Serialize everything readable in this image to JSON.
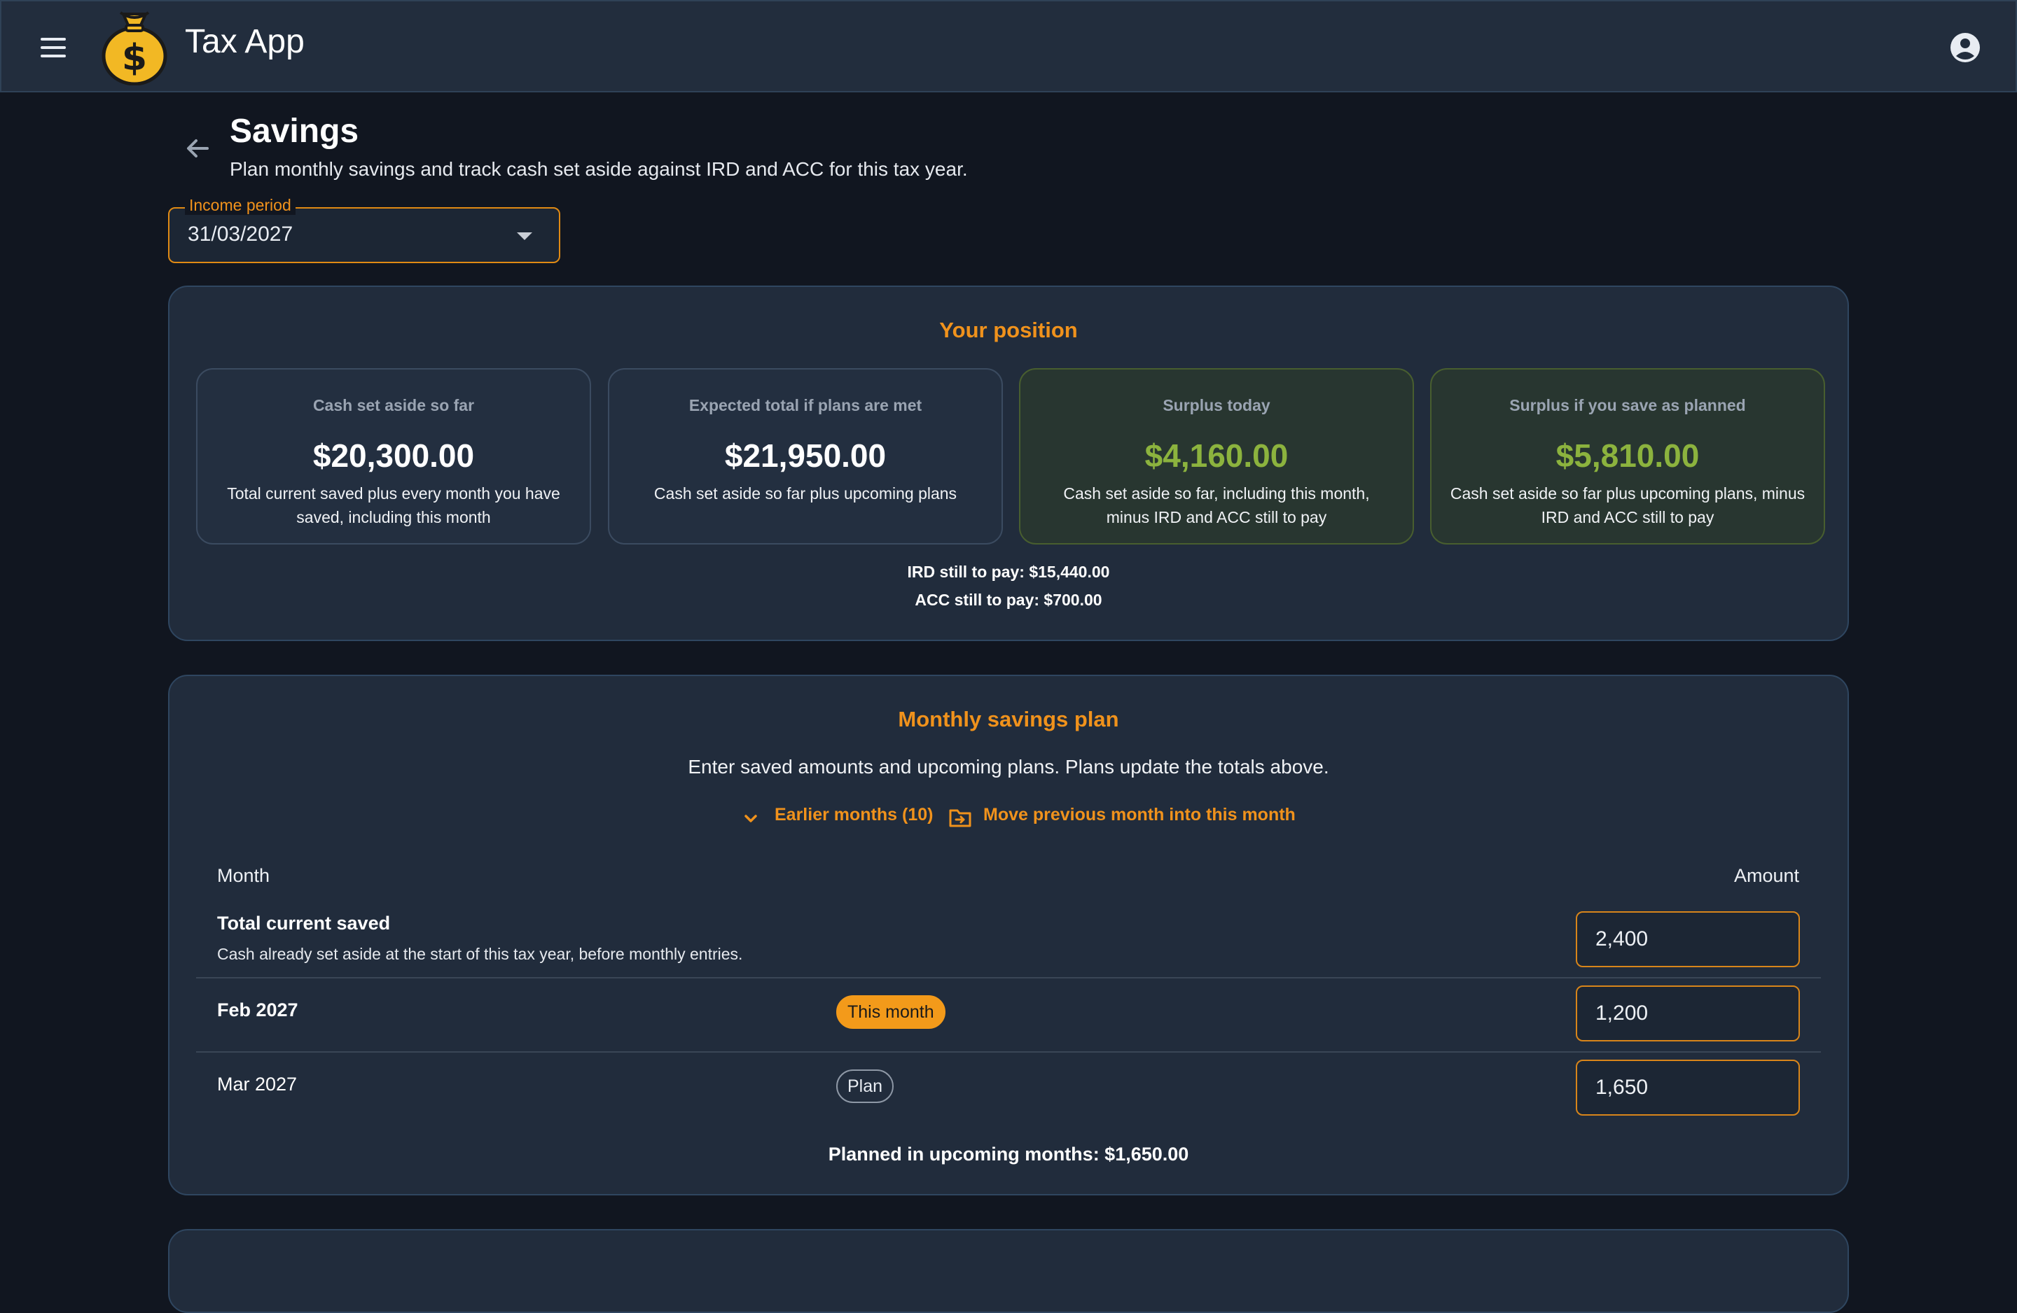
{
  "app": {
    "title": "Tax App",
    "logo_icon": "money-bag-icon",
    "accent": "#f0921c",
    "positive": "#8cb33e"
  },
  "header": {
    "menu_icon": "hamburger-icon",
    "account_icon": "account-circle-icon"
  },
  "page": {
    "title": "Savings",
    "subtitle": "Plan monthly savings and track cash set aside against IRD and ACC for this tax year."
  },
  "income_period": {
    "label": "Income period",
    "value": "31/03/2027"
  },
  "position": {
    "title": "Your position",
    "cards": [
      {
        "label": "Cash set aside so far",
        "value": "$20,300.00",
        "desc": "Total current saved plus every month you have saved, including this month"
      },
      {
        "label": "Expected total if plans are met",
        "value": "$21,950.00",
        "desc": "Cash set aside so far plus upcoming plans"
      },
      {
        "label": "Surplus today",
        "value": "$4,160.00",
        "desc": "Cash set aside so far, including this month, minus IRD and ACC still to pay"
      },
      {
        "label": "Surplus if you save as planned",
        "value": "$5,810.00",
        "desc": "Cash set aside so far plus upcoming plans, minus IRD and ACC still to pay"
      }
    ],
    "ird_line": "IRD still to pay: $15,440.00",
    "acc_line": "ACC still to pay: $700.00"
  },
  "plan": {
    "title": "Monthly savings plan",
    "description": "Enter saved amounts and upcoming plans. Plans update the totals above.",
    "earlier_link": "Earlier months (10)",
    "move_link": "Move previous month into this month",
    "col_month": "Month",
    "col_amount": "Amount",
    "current": {
      "label": "Total current saved",
      "sub": "Cash already set aside at the start of this tax year, before monthly entries.",
      "amount": "2,400"
    },
    "rows": [
      {
        "month": "Feb 2027",
        "chip": "This month",
        "amount": "1,200"
      },
      {
        "month": "Mar 2027",
        "chip": "Plan",
        "amount": "1,650"
      }
    ],
    "planned_total": "Planned in upcoming months: $1,650.00"
  }
}
